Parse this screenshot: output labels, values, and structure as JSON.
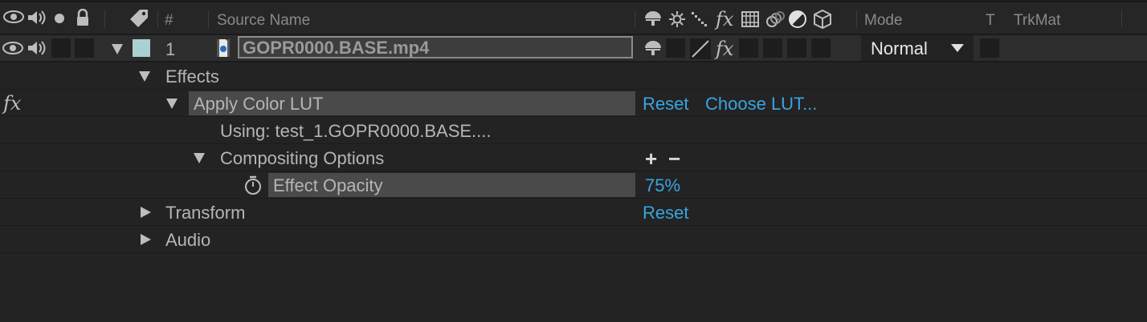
{
  "header": {
    "number_label": "#",
    "source_name_label": "Source Name",
    "fx_label": "fx",
    "mode_label": "Mode",
    "t_label": "T",
    "trkmat_label": "TrkMat"
  },
  "layer": {
    "number": "1",
    "name": "GOPR0000.BASE.mp4",
    "mode": "Normal",
    "fx_label": "fx",
    "label_color": "#a9d1cf"
  },
  "tree": {
    "effects_label": "Effects",
    "fx_badge": "fx",
    "apply_lut_label": "Apply Color LUT",
    "reset_label": "Reset",
    "choose_lut_label": "Choose LUT...",
    "using_label": "Using: test_1.GOPR0000.BASE....",
    "compositing_label": "Compositing Options",
    "plus": "+",
    "minus": "−",
    "effect_opacity_label": "Effect Opacity",
    "effect_opacity_value": "75%",
    "transform_label": "Transform",
    "transform_reset_label": "Reset",
    "audio_label": "Audio"
  },
  "colors": {
    "background": "#232323",
    "link": "#39a4e0",
    "highlight": "#4a4a4a"
  }
}
